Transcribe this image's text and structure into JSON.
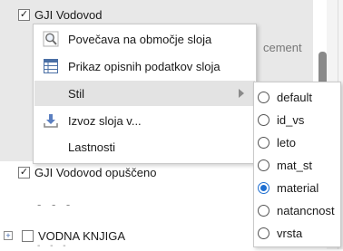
{
  "layers": {
    "top": {
      "label": "GJI Vodovod",
      "checked": "✓"
    },
    "partial_text": "cement",
    "middle": {
      "label": "GJI Vodovod opuščeno",
      "checked": "✓"
    },
    "dashes": "- - -",
    "bottom": {
      "label": "VODNA KNJIGA",
      "expander": "+"
    }
  },
  "context_menu": {
    "items": [
      {
        "label": "Povečava na območje sloja",
        "icon": "zoom-to-layer-icon"
      },
      {
        "label": "Prikaz opisnih podatkov sloja",
        "icon": "attribute-table-icon"
      },
      {
        "label": "Stil",
        "icon": "none",
        "has_submenu": true,
        "active": true
      },
      {
        "label": "Izvoz sloja v...",
        "icon": "export-download-icon"
      },
      {
        "label": "Lastnosti",
        "icon": "none"
      }
    ]
  },
  "style_submenu": {
    "options": [
      "default",
      "id_vs",
      "leto",
      "mat_st",
      "material",
      "natancnost",
      "vrsta"
    ],
    "selected": "material"
  },
  "colors": {
    "accent": "#1f6fd1",
    "active_row": "#e3e3e3",
    "panel_bg": "#e8e8e8"
  }
}
